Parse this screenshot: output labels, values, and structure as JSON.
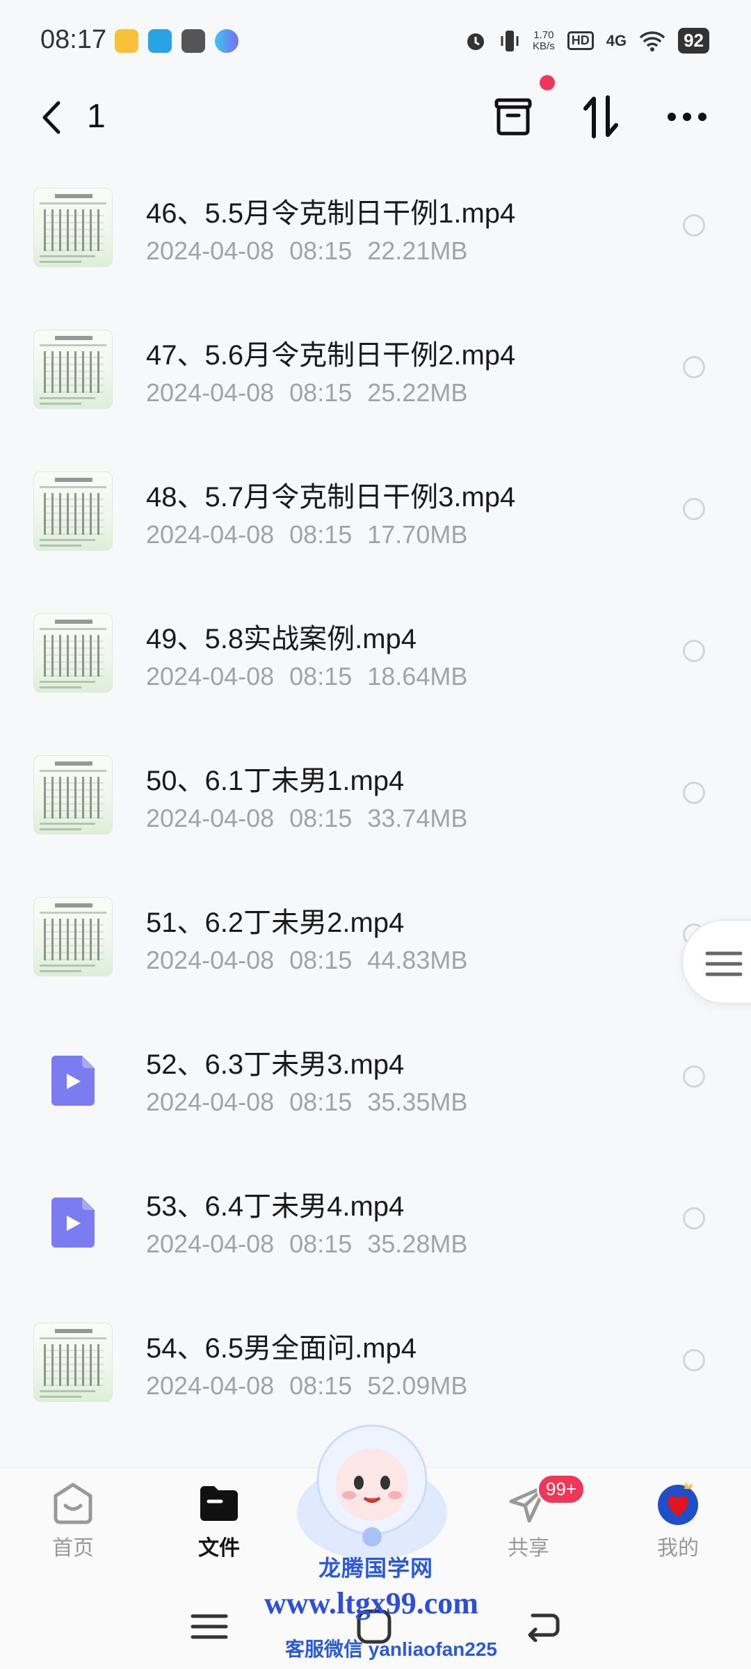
{
  "status_bar": {
    "time": "08:17",
    "net_speed_value": "1.70",
    "net_speed_unit": "KB/s",
    "hd_label": "HD",
    "network": "4G",
    "battery": "92"
  },
  "header": {
    "title": "1"
  },
  "files": [
    {
      "name": "46、5.5月令克制日干例1.mp4",
      "date": "2024-04-08",
      "time": "08:15",
      "size": "22.21MB",
      "thumb": "doc"
    },
    {
      "name": "47、5.6月令克制日干例2.mp4",
      "date": "2024-04-08",
      "time": "08:15",
      "size": "25.22MB",
      "thumb": "doc"
    },
    {
      "name": "48、5.7月令克制日干例3.mp4",
      "date": "2024-04-08",
      "time": "08:15",
      "size": "17.70MB",
      "thumb": "doc"
    },
    {
      "name": "49、5.8实战案例.mp4",
      "date": "2024-04-08",
      "time": "08:15",
      "size": "18.64MB",
      "thumb": "doc"
    },
    {
      "name": "50、6.1丁未男1.mp4",
      "date": "2024-04-08",
      "time": "08:15",
      "size": "33.74MB",
      "thumb": "doc"
    },
    {
      "name": "51、6.2丁未男2.mp4",
      "date": "2024-04-08",
      "time": "08:15",
      "size": "44.83MB",
      "thumb": "doc"
    },
    {
      "name": "52、6.3丁未男3.mp4",
      "date": "2024-04-08",
      "time": "08:15",
      "size": "35.35MB",
      "thumb": "video"
    },
    {
      "name": "53、6.4丁未男4.mp4",
      "date": "2024-04-08",
      "time": "08:15",
      "size": "35.28MB",
      "thumb": "video"
    },
    {
      "name": "54、6.5男全面问.mp4",
      "date": "2024-04-08",
      "time": "08:15",
      "size": "52.09MB",
      "thumb": "doc"
    }
  ],
  "bottom_nav": {
    "items": [
      {
        "label": "首页",
        "icon": "home-icon"
      },
      {
        "label": "文件",
        "icon": "folder-icon",
        "active": true
      },
      {
        "label": "共享",
        "icon": "share-icon",
        "badge": "99+"
      },
      {
        "label": "我的",
        "icon": "profile-icon"
      }
    ]
  },
  "watermark": {
    "title": "龙腾国学网",
    "url": "www.ltgx99.com",
    "wechat": "客服微信 yanliaofan225"
  },
  "colors": {
    "accent_video": "#7b7cf0",
    "badge": "#f0375a",
    "meta_text": "#a0a3a8"
  }
}
